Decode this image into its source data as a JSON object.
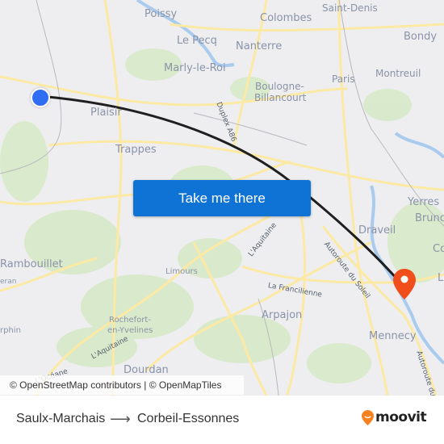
{
  "map": {
    "places": [
      {
        "name": "Poissy",
        "key": "poissy"
      },
      {
        "name": "Colombes",
        "key": "colombes"
      },
      {
        "name": "Saint-Denis",
        "key": "saint-denis"
      },
      {
        "name": "Le Pecq",
        "key": "le-pecq"
      },
      {
        "name": "Nanterre",
        "key": "nanterre"
      },
      {
        "name": "Bondy",
        "key": "bondy"
      },
      {
        "name": "Marly-le-Roi",
        "key": "marly-le-roi"
      },
      {
        "name": "Montreuil",
        "key": "montreuil"
      },
      {
        "name": "Paris",
        "key": "paris"
      },
      {
        "name": "Boulogne-",
        "key": "boulogne-1"
      },
      {
        "name": "Billancourt",
        "key": "boulogne-2"
      },
      {
        "name": "Plaisir",
        "key": "plaisir"
      },
      {
        "name": "Trappes",
        "key": "trappes"
      },
      {
        "name": "Yerres",
        "key": "yerres"
      },
      {
        "name": "Bruno",
        "key": "brunoy"
      },
      {
        "name": "Draveil",
        "key": "draveil"
      },
      {
        "name": "Co",
        "key": "co"
      },
      {
        "name": "Rambouillet",
        "key": "rambouillet"
      },
      {
        "name": "eran",
        "key": "eran"
      },
      {
        "name": "Limours",
        "key": "limours"
      },
      {
        "name": "L",
        "key": "l-right"
      },
      {
        "name": "Arpajon",
        "key": "arpajon"
      },
      {
        "name": "Rochefort-",
        "key": "rochefort-1"
      },
      {
        "name": "en-Yvelines",
        "key": "rochefort-2"
      },
      {
        "name": "rphin",
        "key": "rphin"
      },
      {
        "name": "Mennecy",
        "key": "mennecy"
      },
      {
        "name": "Dourdan",
        "key": "dourdan"
      }
    ],
    "roads": [
      {
        "name": "Duplex A86",
        "key": "duplex"
      },
      {
        "name": "L'Aquitaine",
        "key": "aquitaine-1"
      },
      {
        "name": "La Francilienne",
        "key": "francilienne"
      },
      {
        "name": "Autoroute du Soleil",
        "key": "soleil-1"
      },
      {
        "name": "L'Aquitaine",
        "key": "aquitaine-2"
      },
      {
        "name": "L'Océane",
        "key": "oceane"
      },
      {
        "name": "Autoroute du S",
        "key": "soleil-2"
      }
    ],
    "origin_icon": "origin-dot-icon",
    "destination_icon": "destination-pin-icon",
    "colors": {
      "route": "#1f1f1f",
      "origin": "#2f6ef3",
      "destination": "#f04e1a",
      "cta": "#0f73d6"
    }
  },
  "cta": {
    "label": "Take me there"
  },
  "attribution": "© OpenStreetMap contributors | © OpenMapTiles",
  "footer": {
    "from": "Saulx-Marchais",
    "arrow": "⟶",
    "to": "Corbeil-Essonnes",
    "logo_text": "moovit",
    "logo_icon": "moovit-pin-icon",
    "logo_color": "#f7811e"
  }
}
